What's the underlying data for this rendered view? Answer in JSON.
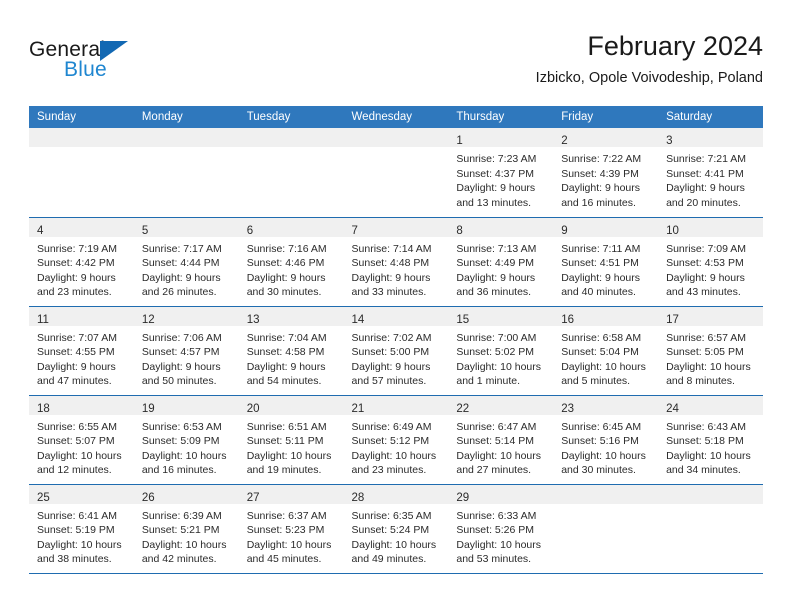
{
  "logo": {
    "word_one": "General",
    "word_two": "Blue",
    "triangle_icon": "blue-triangle-icon",
    "colors": {
      "dark": "#1a1a1a",
      "blue": "#1f86d0",
      "triangle": "#1268b3"
    }
  },
  "header": {
    "title": "February 2024",
    "subtitle": "Izbicko, Opole Voivodeship, Poland"
  },
  "theme": {
    "header_bg": "#2f78bd",
    "row_rule": "#1f6cb0",
    "daynum_band": "#f0f0f0",
    "text": "#2b2b2b"
  },
  "weekday_headers": [
    "Sunday",
    "Monday",
    "Tuesday",
    "Wednesday",
    "Thursday",
    "Friday",
    "Saturday"
  ],
  "weeks": [
    [
      {
        "day": "",
        "lines": []
      },
      {
        "day": "",
        "lines": []
      },
      {
        "day": "",
        "lines": []
      },
      {
        "day": "",
        "lines": []
      },
      {
        "day": "1",
        "lines": [
          "Sunrise: 7:23 AM",
          "Sunset: 4:37 PM",
          "Daylight: 9 hours",
          "and 13 minutes."
        ]
      },
      {
        "day": "2",
        "lines": [
          "Sunrise: 7:22 AM",
          "Sunset: 4:39 PM",
          "Daylight: 9 hours",
          "and 16 minutes."
        ]
      },
      {
        "day": "3",
        "lines": [
          "Sunrise: 7:21 AM",
          "Sunset: 4:41 PM",
          "Daylight: 9 hours",
          "and 20 minutes."
        ]
      }
    ],
    [
      {
        "day": "4",
        "lines": [
          "Sunrise: 7:19 AM",
          "Sunset: 4:42 PM",
          "Daylight: 9 hours",
          "and 23 minutes."
        ]
      },
      {
        "day": "5",
        "lines": [
          "Sunrise: 7:17 AM",
          "Sunset: 4:44 PM",
          "Daylight: 9 hours",
          "and 26 minutes."
        ]
      },
      {
        "day": "6",
        "lines": [
          "Sunrise: 7:16 AM",
          "Sunset: 4:46 PM",
          "Daylight: 9 hours",
          "and 30 minutes."
        ]
      },
      {
        "day": "7",
        "lines": [
          "Sunrise: 7:14 AM",
          "Sunset: 4:48 PM",
          "Daylight: 9 hours",
          "and 33 minutes."
        ]
      },
      {
        "day": "8",
        "lines": [
          "Sunrise: 7:13 AM",
          "Sunset: 4:49 PM",
          "Daylight: 9 hours",
          "and 36 minutes."
        ]
      },
      {
        "day": "9",
        "lines": [
          "Sunrise: 7:11 AM",
          "Sunset: 4:51 PM",
          "Daylight: 9 hours",
          "and 40 minutes."
        ]
      },
      {
        "day": "10",
        "lines": [
          "Sunrise: 7:09 AM",
          "Sunset: 4:53 PM",
          "Daylight: 9 hours",
          "and 43 minutes."
        ]
      }
    ],
    [
      {
        "day": "11",
        "lines": [
          "Sunrise: 7:07 AM",
          "Sunset: 4:55 PM",
          "Daylight: 9 hours",
          "and 47 minutes."
        ]
      },
      {
        "day": "12",
        "lines": [
          "Sunrise: 7:06 AM",
          "Sunset: 4:57 PM",
          "Daylight: 9 hours",
          "and 50 minutes."
        ]
      },
      {
        "day": "13",
        "lines": [
          "Sunrise: 7:04 AM",
          "Sunset: 4:58 PM",
          "Daylight: 9 hours",
          "and 54 minutes."
        ]
      },
      {
        "day": "14",
        "lines": [
          "Sunrise: 7:02 AM",
          "Sunset: 5:00 PM",
          "Daylight: 9 hours",
          "and 57 minutes."
        ]
      },
      {
        "day": "15",
        "lines": [
          "Sunrise: 7:00 AM",
          "Sunset: 5:02 PM",
          "Daylight: 10 hours",
          "and 1 minute."
        ]
      },
      {
        "day": "16",
        "lines": [
          "Sunrise: 6:58 AM",
          "Sunset: 5:04 PM",
          "Daylight: 10 hours",
          "and 5 minutes."
        ]
      },
      {
        "day": "17",
        "lines": [
          "Sunrise: 6:57 AM",
          "Sunset: 5:05 PM",
          "Daylight: 10 hours",
          "and 8 minutes."
        ]
      }
    ],
    [
      {
        "day": "18",
        "lines": [
          "Sunrise: 6:55 AM",
          "Sunset: 5:07 PM",
          "Daylight: 10 hours",
          "and 12 minutes."
        ]
      },
      {
        "day": "19",
        "lines": [
          "Sunrise: 6:53 AM",
          "Sunset: 5:09 PM",
          "Daylight: 10 hours",
          "and 16 minutes."
        ]
      },
      {
        "day": "20",
        "lines": [
          "Sunrise: 6:51 AM",
          "Sunset: 5:11 PM",
          "Daylight: 10 hours",
          "and 19 minutes."
        ]
      },
      {
        "day": "21",
        "lines": [
          "Sunrise: 6:49 AM",
          "Sunset: 5:12 PM",
          "Daylight: 10 hours",
          "and 23 minutes."
        ]
      },
      {
        "day": "22",
        "lines": [
          "Sunrise: 6:47 AM",
          "Sunset: 5:14 PM",
          "Daylight: 10 hours",
          "and 27 minutes."
        ]
      },
      {
        "day": "23",
        "lines": [
          "Sunrise: 6:45 AM",
          "Sunset: 5:16 PM",
          "Daylight: 10 hours",
          "and 30 minutes."
        ]
      },
      {
        "day": "24",
        "lines": [
          "Sunrise: 6:43 AM",
          "Sunset: 5:18 PM",
          "Daylight: 10 hours",
          "and 34 minutes."
        ]
      }
    ],
    [
      {
        "day": "25",
        "lines": [
          "Sunrise: 6:41 AM",
          "Sunset: 5:19 PM",
          "Daylight: 10 hours",
          "and 38 minutes."
        ]
      },
      {
        "day": "26",
        "lines": [
          "Sunrise: 6:39 AM",
          "Sunset: 5:21 PM",
          "Daylight: 10 hours",
          "and 42 minutes."
        ]
      },
      {
        "day": "27",
        "lines": [
          "Sunrise: 6:37 AM",
          "Sunset: 5:23 PM",
          "Daylight: 10 hours",
          "and 45 minutes."
        ]
      },
      {
        "day": "28",
        "lines": [
          "Sunrise: 6:35 AM",
          "Sunset: 5:24 PM",
          "Daylight: 10 hours",
          "and 49 minutes."
        ]
      },
      {
        "day": "29",
        "lines": [
          "Sunrise: 6:33 AM",
          "Sunset: 5:26 PM",
          "Daylight: 10 hours",
          "and 53 minutes."
        ]
      },
      {
        "day": "",
        "lines": []
      },
      {
        "day": "",
        "lines": []
      }
    ]
  ]
}
